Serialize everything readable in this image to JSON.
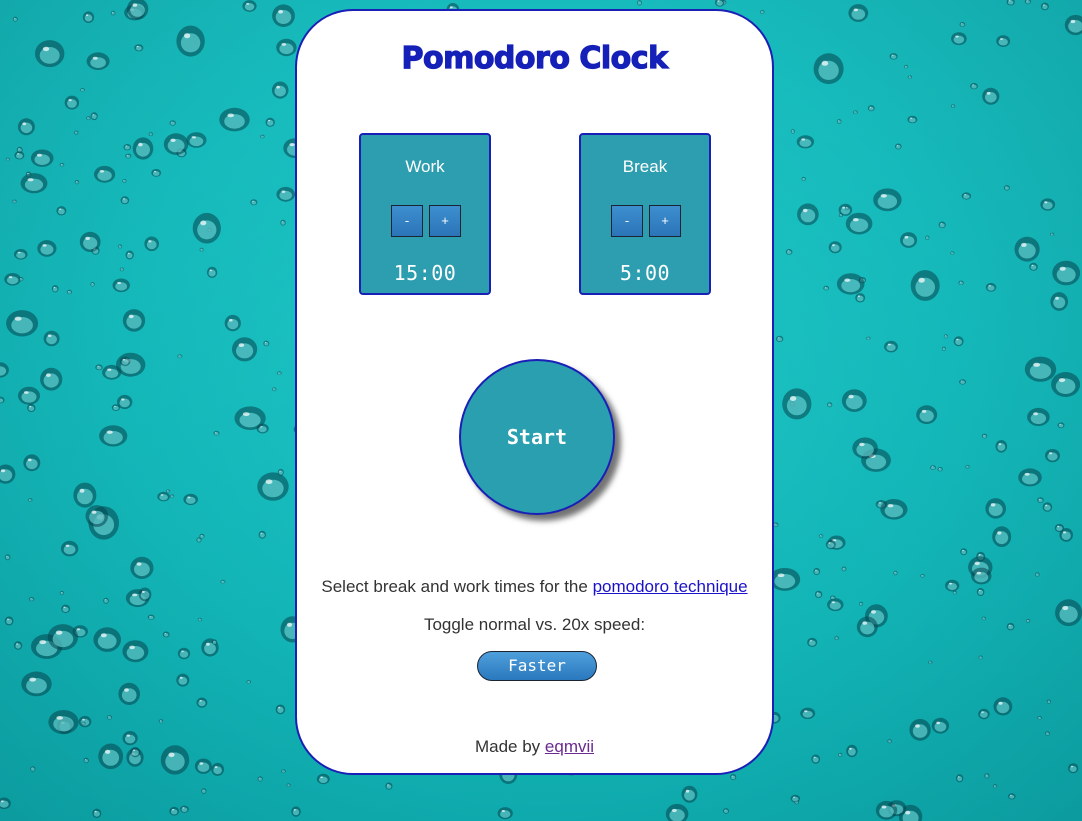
{
  "app": {
    "title": "Pomodoro Clock"
  },
  "work": {
    "label": "Work",
    "minus_label": "-",
    "plus_label": "+",
    "time": "15:00"
  },
  "break": {
    "label": "Break",
    "minus_label": "-",
    "plus_label": "+",
    "time": "5:00"
  },
  "start_button": {
    "label": "Start"
  },
  "info": {
    "intro_prefix": "Select break and work times for the ",
    "intro_link": "pomodoro technique",
    "toggle_label": "Toggle normal vs. 20x speed:",
    "faster_label": "Faster"
  },
  "footer": {
    "made_by_prefix": "Made by ",
    "author": "eqmvii"
  },
  "icons": {
    "background": "water-drops-background"
  },
  "colors": {
    "background": "#14b6b8",
    "card": "#ffffff",
    "card_border": "#1a1fb5",
    "title": "#1420b8",
    "panel": "#2d9db0",
    "button": "#2b74b8",
    "link": "#1a12c8",
    "visited_link": "#6b2a8f"
  }
}
